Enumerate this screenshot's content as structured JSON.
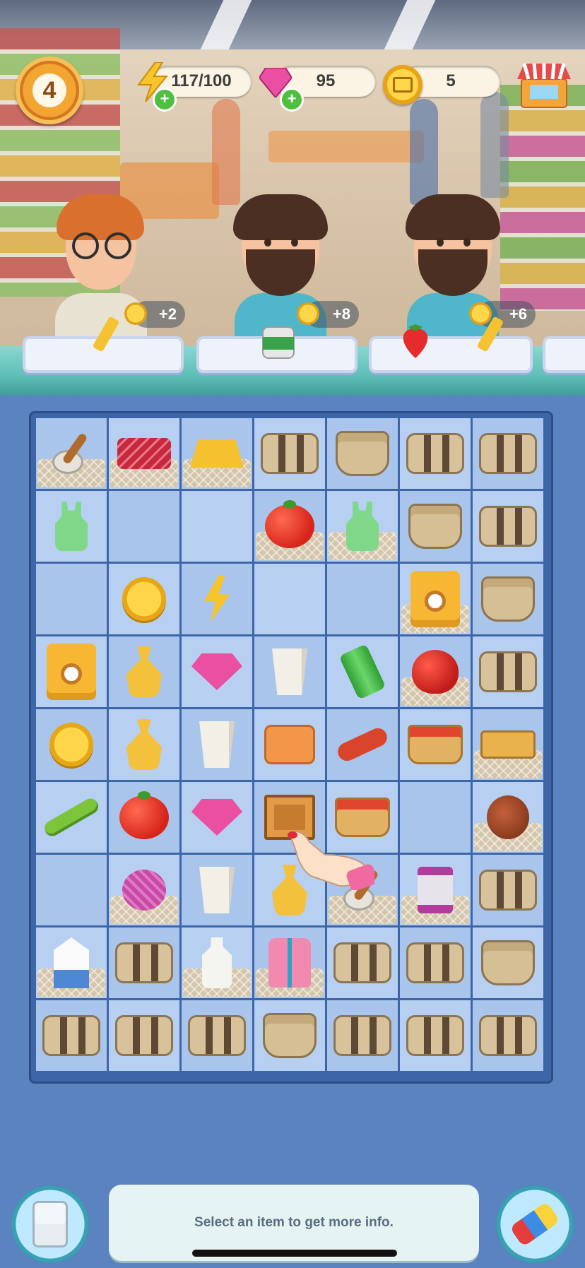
{
  "hud": {
    "level": "4",
    "energy": "117/100",
    "gems": "95",
    "coins": "5",
    "plus": "+"
  },
  "customers": [
    {
      "reward": "+2",
      "order_icon": "candy"
    },
    {
      "reward": "+8",
      "order_icon": "canned-food"
    },
    {
      "reward": "+6",
      "order_icon": "strawberry-and-candy"
    }
  ],
  "board": {
    "rows": [
      [
        "scoop-web",
        "meat-web",
        "gold-bars-web",
        "basket-box",
        "basket-round",
        "basket-box",
        "basket-box"
      ],
      [
        "tank-top",
        "empty",
        "empty",
        "tomato-web",
        "tank-top-web",
        "basket-round",
        "basket-box"
      ],
      [
        "empty",
        "coins",
        "energy-bolt",
        "empty",
        "empty",
        "cookie-bag-web",
        "basket-round"
      ],
      [
        "cookie-bag",
        "gold-sack",
        "gems",
        "paper-cup",
        "energy-can",
        "apple-web",
        "basket-box"
      ],
      [
        "coin",
        "gold-sack",
        "paper-cup",
        "locked-chest",
        "sausage",
        "veggie-basket",
        "tray-web"
      ],
      [
        "pea-pod",
        "tomato",
        "gems",
        "wooden-box",
        "veggie-basket",
        "empty",
        "ham-web"
      ],
      [
        "empty",
        "yarn-web",
        "paper-cup",
        "gold-sack",
        "scoop-web",
        "thread-spool-web",
        "basket-box"
      ],
      [
        "milk-carton-web",
        "basket-box",
        "milk-bottle-web",
        "vest-web",
        "basket-box",
        "basket-box",
        "basket-round"
      ],
      [
        "basket-box",
        "basket-box",
        "basket-box",
        "basket-round",
        "basket-box",
        "basket-box",
        "basket-box"
      ]
    ]
  },
  "bottom": {
    "info_text": "Select an item to get more info."
  }
}
